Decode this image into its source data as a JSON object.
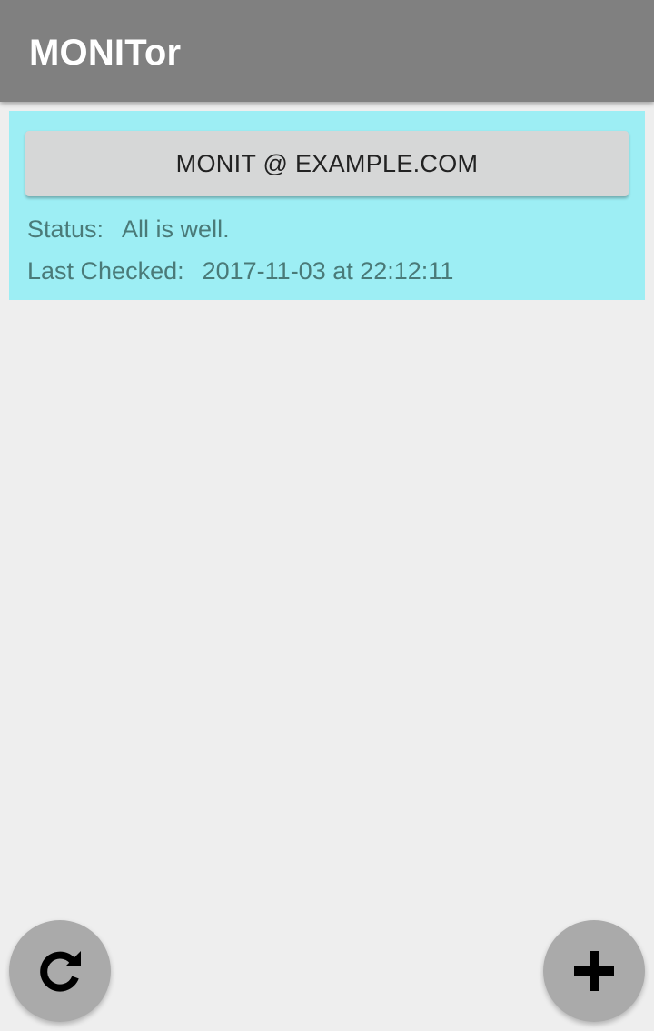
{
  "app": {
    "title": "MONITor"
  },
  "servers": [
    {
      "name": "MONIT @ EXAMPLE.COM",
      "status_label": "Status:",
      "status_value": "All is well.",
      "checked_label": "Last Checked:",
      "checked_value": "2017-11-03 at 22:12:11"
    }
  ],
  "fabs": {
    "refresh_icon": "refresh-icon",
    "add_icon": "plus-icon"
  },
  "colors": {
    "appbar": "#808080",
    "background": "#eeeeee",
    "card": "#9deef4",
    "button": "#d6d7d7",
    "info_text": "#4a7a78",
    "fab": "#aaaaaa"
  }
}
